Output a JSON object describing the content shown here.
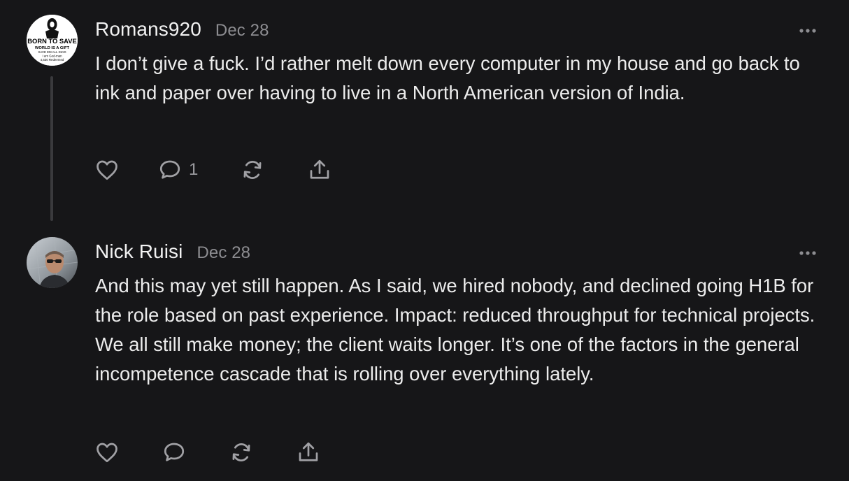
{
  "comments": [
    {
      "author": "Romans920",
      "date": "Dec 28",
      "avatar_text": [
        "BORN TO SAVE",
        "WORLD IS A GIFT",
        "SAVE EM ALL 33AD",
        "I am God-man",
        "4,530 Redeemed"
      ],
      "body": "I don’t give a fuck. I’d rather melt down every computer in my house and go back to ink and paper over having to live in a North American version of India.",
      "reply_count": "1",
      "icons": [
        "heart-icon",
        "comment-icon",
        "restack-icon",
        "share-icon",
        "more-icon"
      ]
    },
    {
      "author": "Nick Ruisi",
      "date": "Dec 28",
      "body": "And this may yet still happen. As I said, we hired nobody, and declined going H1B for the role based on past experience. Impact: reduced throughput for technical projects. We all still make money; the client waits longer. It’s one of the factors in the general incompetence cascade that is rolling over everything lately.",
      "reply_count": "",
      "icons": [
        "heart-icon",
        "comment-icon",
        "restack-icon",
        "share-icon",
        "more-icon"
      ]
    }
  ],
  "colors": {
    "background": "#161618",
    "text": "#ececec",
    "muted": "#8d8d91",
    "thread_line": "#3a3a3d"
  }
}
